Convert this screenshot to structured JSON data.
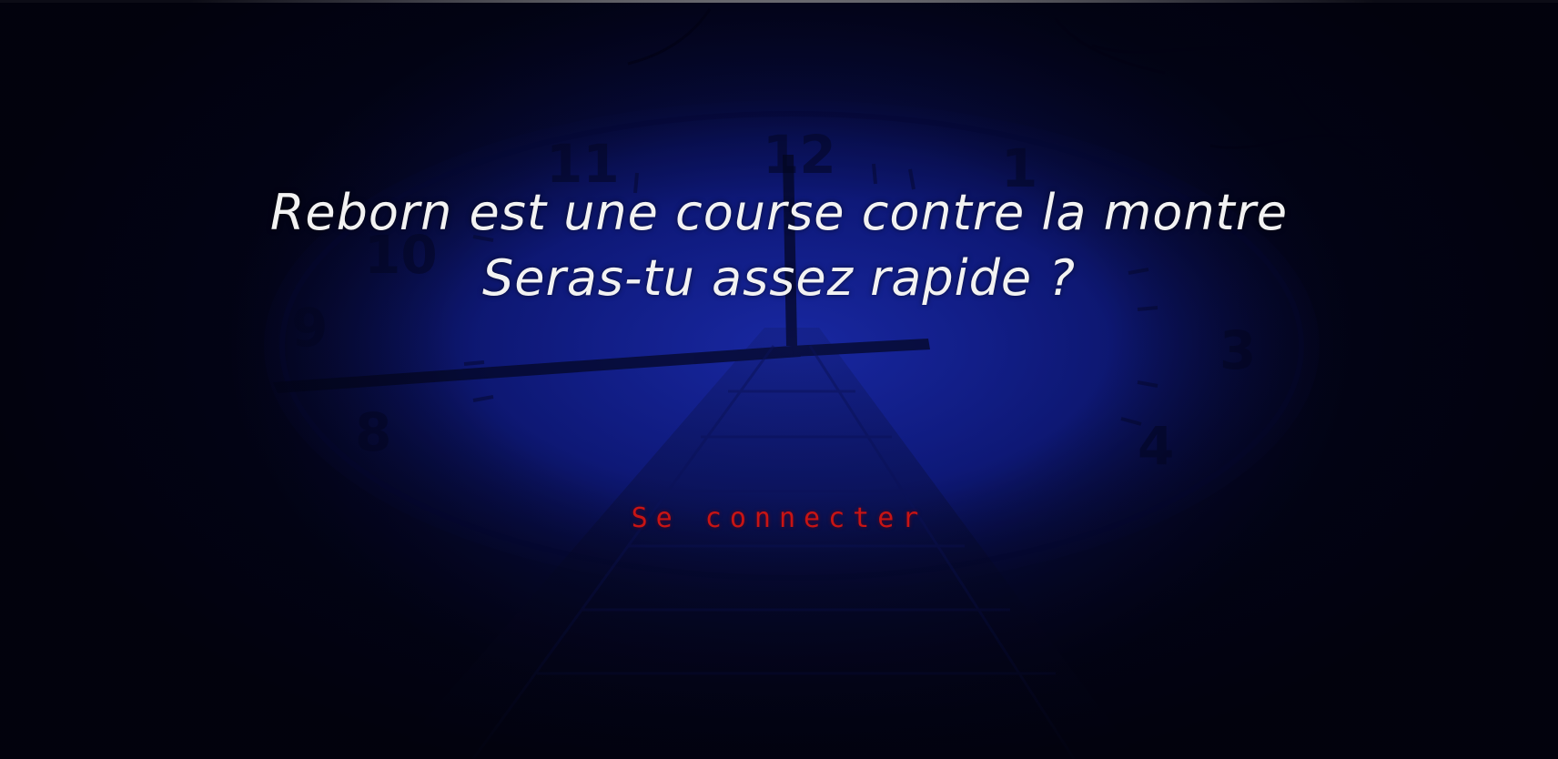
{
  "hero": {
    "line1": "Reborn est une course contre la montre",
    "line2": "Seras-tu assez rapide ?"
  },
  "actions": {
    "login_label": "Se connecter"
  },
  "background": {
    "clock_numerals": [
      "11",
      "12",
      "1",
      "10",
      "9",
      "3",
      "8",
      "4"
    ]
  },
  "colors": {
    "background_dark": "#05051a",
    "clock_blue": "#0f1a7a",
    "text_white": "#f2f2f2",
    "login_red": "#c81414"
  }
}
